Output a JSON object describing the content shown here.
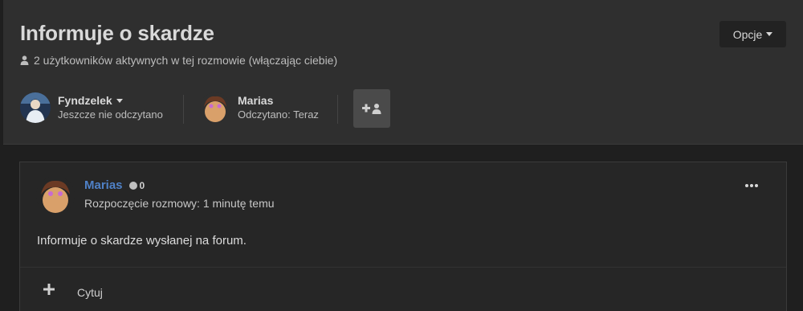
{
  "header": {
    "title": "Informuje o skardze",
    "active_users": "2 użytkowników aktywnych w tej rozmowie (włączając ciebie)",
    "options_label": "Opcje"
  },
  "participants": [
    {
      "name": "Fyndzelek",
      "status": "Jeszcze nie odczytano"
    },
    {
      "name": "Marias",
      "status": "Odczytano: Teraz"
    }
  ],
  "post": {
    "author": "Marias",
    "reputation": "0",
    "date": "Rozpoczęcie rozmowy: 1 minutę temu",
    "body": "Informuje o skardze wysłanej na forum.",
    "quote_label": "Cytuj"
  },
  "colors": {
    "header_bg": "#2f2f2f",
    "page_bg": "#1f1f1f",
    "author_link": "#4f81c7",
    "add_button": "#4a4a4a"
  },
  "icons": [
    "user-icon",
    "caret-down-icon",
    "add-participant-icon",
    "more-options-icon",
    "plus-icon",
    "reputation-dot-icon"
  ]
}
